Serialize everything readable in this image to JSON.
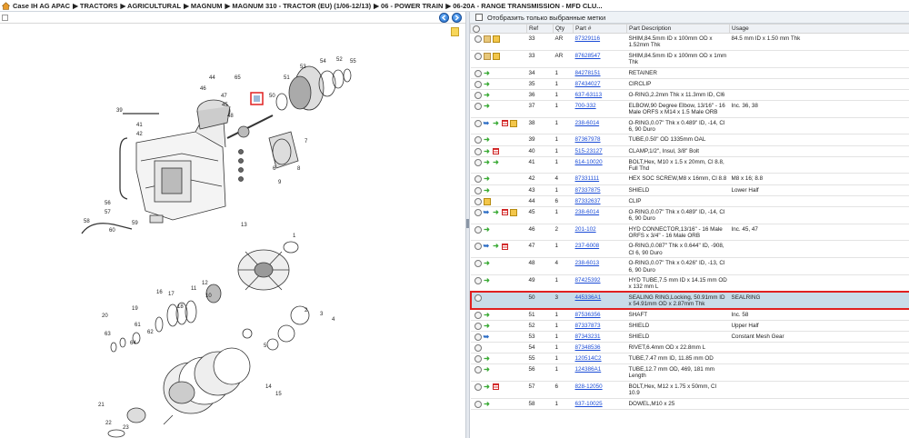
{
  "breadcrumb": {
    "items": [
      "Case IH AG APAC",
      "▶ TRACTORS",
      "▶ AGRICULTURAL",
      "▶ MAGNUM",
      "▶ MAGNUM 310 - TRACTOR (EU) (1/06-12/13)",
      "▶ 06 - POWER TRAIN",
      "▶ 06-20A - RANGE TRANSMISSION - MFD CLU..."
    ]
  },
  "filter": {
    "label": "Отобразить только выбранные метки"
  },
  "table": {
    "headers": [
      "",
      "Ref",
      "Qty",
      "Part #",
      "Part Description",
      "Usage"
    ],
    "rows": [
      {
        "icons": [
          "mag",
          "fold",
          "box"
        ],
        "ref": "33",
        "qty": "AR",
        "part": "87329116",
        "desc": "SHIM,84.5mm ID x 100mm OD x 1.52mm Thk",
        "usage": "84.5 mm ID x 1.50 mm Thk"
      },
      {
        "icons": [
          "mag",
          "fold",
          "box"
        ],
        "ref": "33",
        "qty": "AR",
        "part": "87628547",
        "desc": "SHIM,84.5mm ID x 100mm OD x 1mm Thk",
        "usage": ""
      },
      {
        "icons": [
          "mag",
          "arrow"
        ],
        "ref": "34",
        "qty": "1",
        "part": "84278151",
        "desc": "RETAINER",
        "usage": ""
      },
      {
        "icons": [
          "mag",
          "arrow"
        ],
        "ref": "35",
        "qty": "1",
        "part": "87434027",
        "desc": "CIRCLIP",
        "usage": ""
      },
      {
        "icons": [
          "mag",
          "arrow"
        ],
        "ref": "36",
        "qty": "1",
        "part": "637-63113",
        "desc": "O-RING,2.2mm Thk x 11.3mm ID, Cl6",
        "usage": ""
      },
      {
        "icons": [
          "mag",
          "arrow"
        ],
        "ref": "37",
        "qty": "1",
        "part": "700-332",
        "desc": "ELBOW,90 Degree Elbow, 13/16\" - 16 Male ORFS x M14 x 1.5 Male ORB",
        "usage": "Inc. 36, 38"
      },
      {
        "icons": [
          "mag",
          "blue",
          "arrow",
          "lines",
          "box"
        ],
        "ref": "38",
        "qty": "1",
        "part": "238-6014",
        "desc": "O-RING,0.07\" Thk x 0.489\" ID, -14, Cl 6, 90 Duro",
        "usage": ""
      },
      {
        "icons": [
          "mag",
          "arrow"
        ],
        "ref": "39",
        "qty": "1",
        "part": "87367978",
        "desc": "TUBE,0.50\" OD 1335mm OAL",
        "usage": ""
      },
      {
        "icons": [
          "mag",
          "arrow",
          "lines"
        ],
        "ref": "40",
        "qty": "1",
        "part": "515-23127",
        "desc": "CLAMP,1/2\", Insul, 3/8\" Bolt",
        "usage": ""
      },
      {
        "icons": [
          "mag",
          "arrow",
          "arrow"
        ],
        "ref": "41",
        "qty": "1",
        "part": "614-10020",
        "desc": "BOLT,Hex, M10 x 1.5 x 20mm, Cl 8.8, Full Thd",
        "usage": ""
      },
      {
        "icons": [
          "mag",
          "arrow"
        ],
        "ref": "42",
        "qty": "4",
        "part": "87331111",
        "desc": "HEX SOC SCREW,M8 x 16mm, Cl 8.8",
        "usage": "M8 x 16; 8.8"
      },
      {
        "icons": [
          "mag",
          "arrow"
        ],
        "ref": "43",
        "qty": "1",
        "part": "87337875",
        "desc": "SHIELD",
        "usage": "Lower Half"
      },
      {
        "icons": [
          "mag",
          "box"
        ],
        "ref": "44",
        "qty": "6",
        "part": "87332637",
        "desc": "CLIP",
        "usage": ""
      },
      {
        "icons": [
          "mag",
          "blue",
          "arrow",
          "lines",
          "box"
        ],
        "ref": "45",
        "qty": "1",
        "part": "238-6014",
        "desc": "O-RING,0.07\" Thk x 0.489\" ID, -14, Cl 6, 90 Duro",
        "usage": ""
      },
      {
        "icons": [
          "mag",
          "arrow"
        ],
        "ref": "46",
        "qty": "2",
        "part": "201-102",
        "desc": "HYD CONNECTOR,13/16\" - 16 Male ORFS x 3/4\" - 16 Male ORB",
        "usage": "Inc. 45, 47"
      },
      {
        "icons": [
          "mag",
          "blue",
          "arrow",
          "lines"
        ],
        "ref": "47",
        "qty": "1",
        "part": "237-6008",
        "desc": "O-RING,0.087\" Thk x 0.644\" ID, -908, Cl 6, 90 Duro",
        "usage": ""
      },
      {
        "icons": [
          "mag",
          "arrow"
        ],
        "ref": "48",
        "qty": "4",
        "part": "238-6013",
        "desc": "O-RING,0.07\" Thk x 0.426\" ID, -13, Cl 6, 90 Duro",
        "usage": ""
      },
      {
        "icons": [
          "mag",
          "arrow"
        ],
        "ref": "49",
        "qty": "1",
        "part": "87425392",
        "desc": "HYD TUBE,7.5 mm ID x 14.15 mm OD x 132 mm L",
        "usage": ""
      },
      {
        "icons": [
          "mag"
        ],
        "ref": "50",
        "qty": "3",
        "part": "445336A1",
        "desc": "SEALING RING,Locking, 50.91mm ID x 54.91mm OD x 2.87mm Thk",
        "usage": "SEALRING",
        "selected": true
      },
      {
        "icons": [
          "mag",
          "arrow"
        ],
        "ref": "51",
        "qty": "1",
        "part": "87536356",
        "desc": "SHAFT",
        "usage": "Inc. 58"
      },
      {
        "icons": [
          "mag",
          "arrow"
        ],
        "ref": "52",
        "qty": "1",
        "part": "87337873",
        "desc": "SHIELD",
        "usage": "Upper Half"
      },
      {
        "icons": [
          "mag",
          "blue"
        ],
        "ref": "53",
        "qty": "1",
        "part": "87343231",
        "desc": "SHIELD",
        "usage": "Constant Mesh Gear"
      },
      {
        "icons": [
          "mag"
        ],
        "ref": "54",
        "qty": "1",
        "part": "87348536",
        "desc": "RIVET,6.4mm OD x 22.8mm L",
        "usage": ""
      },
      {
        "icons": [
          "mag",
          "arrow"
        ],
        "ref": "55",
        "qty": "1",
        "part": "120514C2",
        "desc": "TUBE,7.47 mm ID, 11.85 mm OD",
        "usage": ""
      },
      {
        "icons": [
          "mag",
          "arrow"
        ],
        "ref": "56",
        "qty": "1",
        "part": "124386A1",
        "desc": "TUBE,12.7 mm OD, 469, 181 mm Length",
        "usage": ""
      },
      {
        "icons": [
          "mag",
          "arrow",
          "lines"
        ],
        "ref": "57",
        "qty": "6",
        "part": "828-12050",
        "desc": "BOLT,Hex, M12 x 1.75 x 50mm, Cl 10.9",
        "usage": ""
      },
      {
        "icons": [
          "mag",
          "arrow"
        ],
        "ref": "58",
        "qty": "1",
        "part": "637-10025",
        "desc": "DOWEL,M10 x 25",
        "usage": ""
      }
    ]
  },
  "diagram": {
    "callouts": [
      "44",
      "46",
      "45",
      "47",
      "48",
      "65",
      "50",
      "51",
      "54",
      "53",
      "52",
      "55",
      "41",
      "42",
      "39",
      "56",
      "57",
      "58",
      "60",
      "59",
      "13",
      "12",
      "11",
      "10",
      "16",
      "17",
      "18",
      "19",
      "20",
      "61",
      "62",
      "63",
      "64",
      "21",
      "22",
      "23",
      "14",
      "15",
      "1",
      "2",
      "3",
      "4",
      "5",
      "6",
      "7",
      "8",
      "9"
    ]
  },
  "colors": {
    "accent": "#1a4bd6",
    "selection": "#c9dce9",
    "highlight": "#e02020"
  }
}
